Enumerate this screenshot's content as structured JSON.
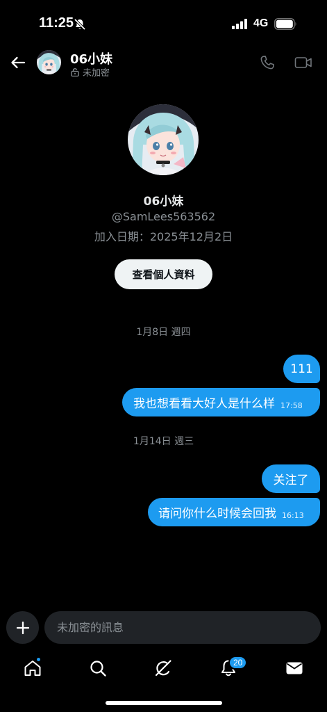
{
  "status_bar": {
    "time": "11:25",
    "network": "4G"
  },
  "header": {
    "name": "06小妹",
    "encryption": "未加密"
  },
  "profile": {
    "name": "06小妹",
    "handle": "@SamLees563562",
    "joined": "加入日期：2025年12月2日",
    "view_profile_label": "查看個人資料"
  },
  "conversation": {
    "groups": [
      {
        "date": "1月8日 週四",
        "messages": [
          {
            "text": "111",
            "time": ""
          },
          {
            "text": "我也想看看大好人是什么样",
            "time": "17:58"
          }
        ]
      },
      {
        "date": "1月14日 週三",
        "messages": [
          {
            "text": "关注了",
            "time": ""
          },
          {
            "text": "请问你什么时候会回我",
            "time": "16:13"
          }
        ]
      }
    ]
  },
  "composer": {
    "placeholder": "未加密的訊息"
  },
  "nav": {
    "notifications_badge": "20"
  },
  "colors": {
    "accent": "#1d9bf0",
    "background": "#000000",
    "input_bg": "#202327"
  }
}
